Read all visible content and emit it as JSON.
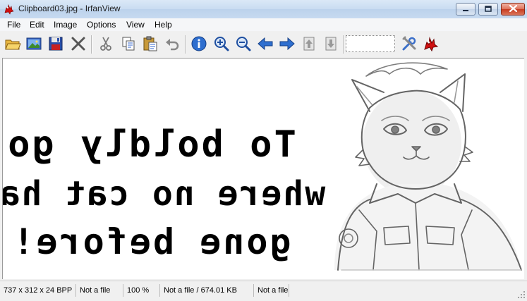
{
  "window": {
    "title": "Clipboard03.jpg - IrfanView"
  },
  "menu": {
    "items": [
      "File",
      "Edit",
      "Image",
      "Options",
      "View",
      "Help"
    ]
  },
  "toolbar": {
    "buttons": [
      {
        "icon": "open-folder-icon"
      },
      {
        "icon": "thumbnails-icon"
      },
      {
        "icon": "save-icon"
      },
      {
        "icon": "delete-icon"
      },
      {
        "icon": "cut-icon"
      },
      {
        "icon": "copy-icon"
      },
      {
        "icon": "paste-icon"
      },
      {
        "icon": "undo-icon"
      },
      {
        "icon": "info-icon"
      },
      {
        "icon": "zoom-in-icon"
      },
      {
        "icon": "zoom-out-icon"
      },
      {
        "icon": "previous-icon"
      },
      {
        "icon": "next-icon"
      },
      {
        "icon": "first-page-icon"
      },
      {
        "icon": "last-page-icon"
      },
      {
        "icon": "properties-icon"
      },
      {
        "icon": "irfanview-logo-icon"
      }
    ]
  },
  "image": {
    "text_lines": [
      "To boldly go",
      "where no cat has",
      "gone before!"
    ],
    "text_mirrored": true
  },
  "statusbar": {
    "cells": [
      "737 x 312 x 24 BPP",
      "Not a file",
      "100 %",
      "Not a file / 674.01 KB",
      "Not a file"
    ]
  },
  "colors": {
    "accent": "#1f5fb3",
    "close_button": "#c73b1f",
    "logo_red": "#d01010"
  }
}
